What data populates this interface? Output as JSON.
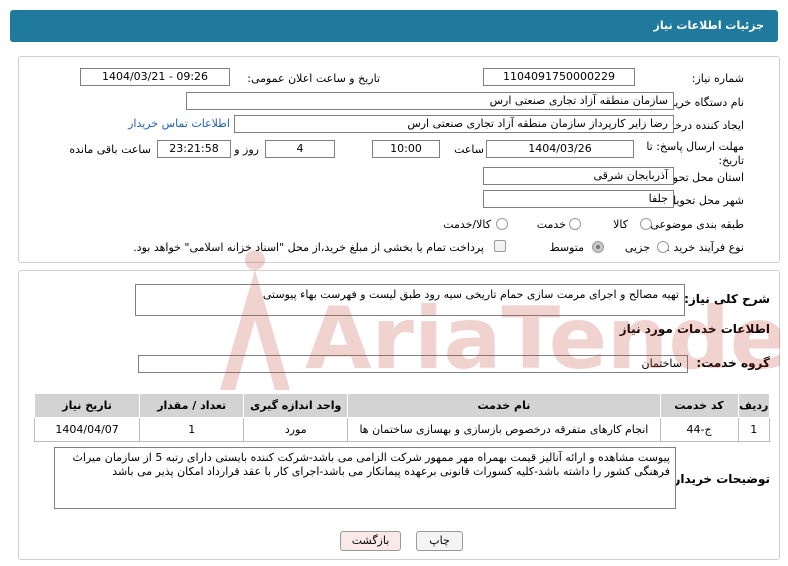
{
  "header": {
    "title": "جزئیات اطلاعات نیاز"
  },
  "form": {
    "need_number_label": "شماره نیاز:",
    "need_number": "1104091750000229",
    "announce_label": "تاریخ و ساعت اعلان عمومی:",
    "announce_value": "1404/03/21 - 09:26",
    "buyer_label": "نام دستگاه خریدار:",
    "buyer_value": "سازمان منطقه آزاد تجاری صنعتی ارس",
    "creator_label": "ایجاد کننده درخواست:",
    "creator_value": "رضا زایر کارپرداز سازمان منطقه آزاد تجاری صنعتی ارس",
    "contact_link": "اطلاعات تماس خریدار",
    "deadline_label_1": "مهلت ارسال پاسخ: تا",
    "deadline_label_2": "تاریخ:",
    "deadline_date": "1404/03/26",
    "time_label": "ساعت",
    "deadline_time": "10:00",
    "days_value": "4",
    "days_label": "روز و",
    "remaining_time": "23:21:58",
    "remaining_label": "ساعت باقی مانده",
    "province_label": "استان محل تحویل:",
    "province_value": "آذربایجان شرقی",
    "city_label": "شهر محل تحویل:",
    "city_value": "جلفا",
    "category_label": "طبقه بندی موضوعی:",
    "category_options": [
      "کالا",
      "خدمت",
      "کالا/خدمت"
    ],
    "process_label": "نوع فرآیند خرید :",
    "process_options": [
      "جزیی",
      "متوسط"
    ],
    "payment_note": "پرداخت تمام یا بخشی از مبلغ خرید،از محل \"اسناد خزانه اسلامی\" خواهد بود."
  },
  "summary": {
    "label": "شرح کلی نیاز:",
    "value": "تهیه مصالح و اجرای مرمت سازی حمام تاریخی سیه رود طبق لیست و فهرست بهاء پیوستی"
  },
  "services": {
    "title": "اطلاعات خدمات مورد نیاز",
    "group_label": "گروه خدمت:",
    "group_value": "ساختمان",
    "columns": [
      "ردیف",
      "کد خدمت",
      "نام خدمت",
      "واحد اندازه گیری",
      "تعداد / مقدار",
      "تاریخ نیاز"
    ],
    "rows": [
      [
        "1",
        "ج-44",
        "انجام کارهای متفرقه درخصوص بازسازی و بهسازی ساختمان ها",
        "مورد",
        "1",
        "1404/04/07"
      ]
    ]
  },
  "notes": {
    "label": "توضیحات خریدار:",
    "value": "پیوست مشاهده و ارائه آنالیز قیمت بهمراه مهر ممهور شرکت الزامی می باشد-شرکت کننده بایستی دارای رتبه 5 از سازمان میراث فرهنگی کشور را داشته باشد-کلیه کسورات قانونی برعهده پیمانکار می باشد-اجرای کار با عقد قرارداد امکان پذیر می باشد"
  },
  "buttons": {
    "print": "چاپ",
    "back": "بازگشت"
  },
  "watermark": {
    "text": "AriaTender.neT"
  },
  "colors": {
    "header": "#1f7a9d",
    "link": "#1f5fb0",
    "watermark": "#c0392b"
  }
}
